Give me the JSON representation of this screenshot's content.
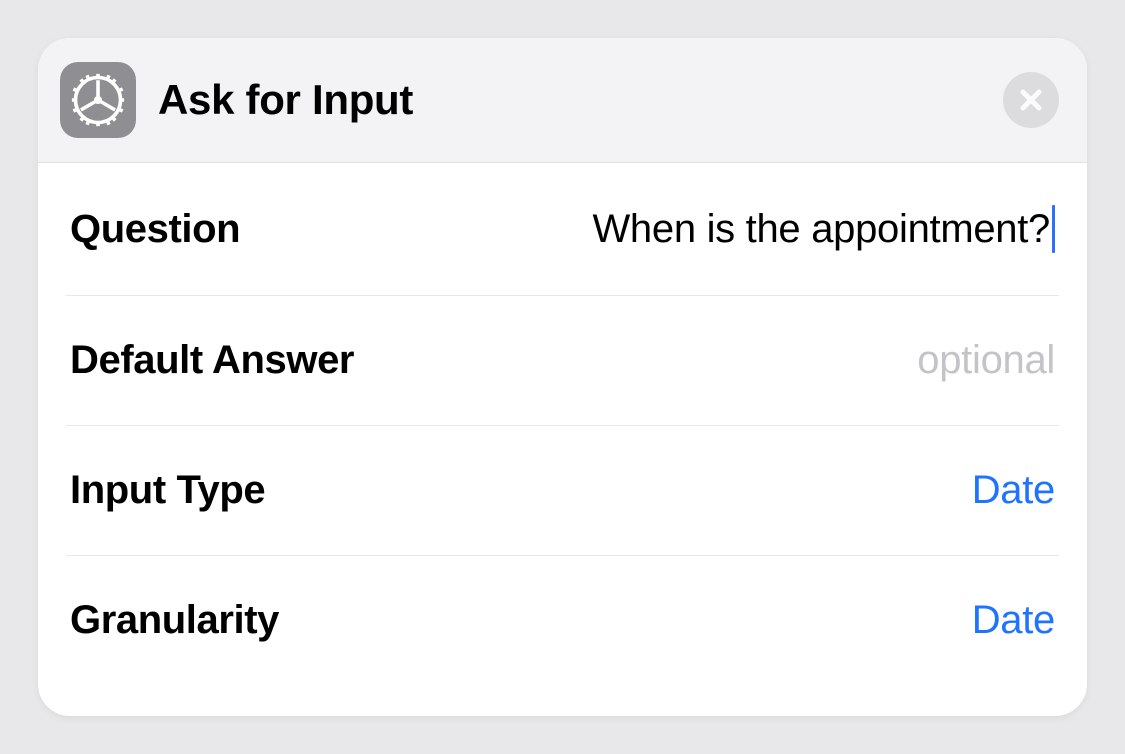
{
  "header": {
    "title": "Ask for Input",
    "icon": "gear-icon"
  },
  "rows": {
    "question": {
      "label": "Question",
      "value": "When is the appointment?"
    },
    "default_answer": {
      "label": "Default Answer",
      "placeholder": "optional",
      "value": ""
    },
    "input_type": {
      "label": "Input Type",
      "value": "Date"
    },
    "granularity": {
      "label": "Granularity",
      "value": "Date"
    }
  }
}
